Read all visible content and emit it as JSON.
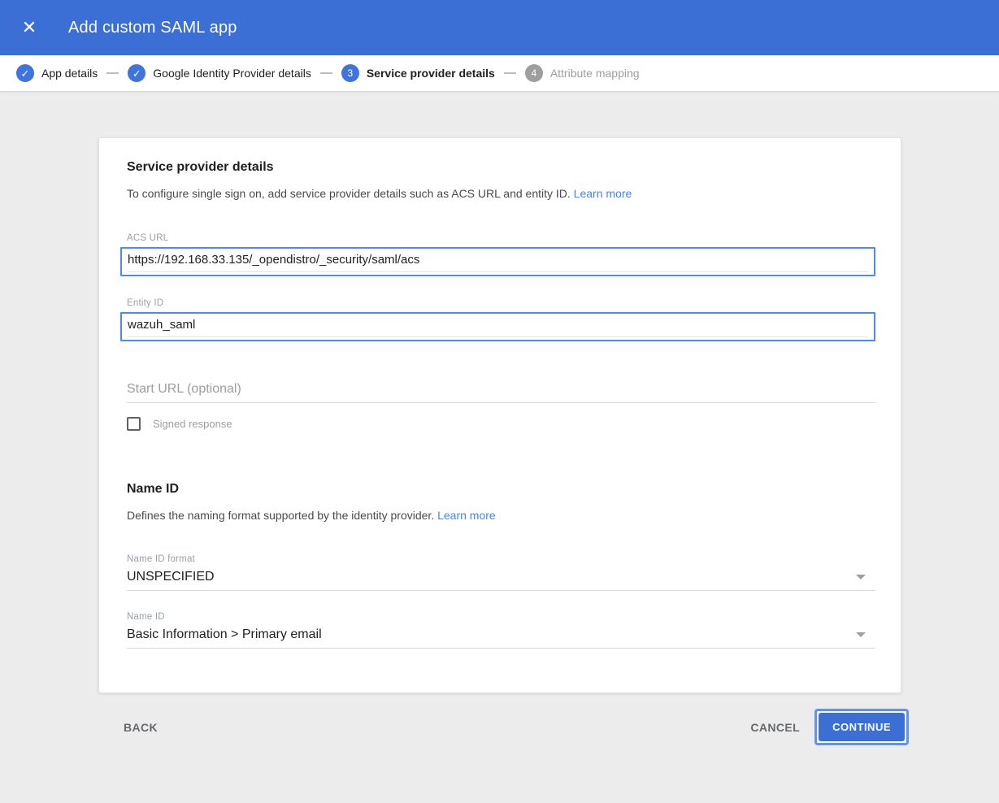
{
  "colors": {
    "header_bg": "#3b6fd6",
    "accent_blue": "#4285f4",
    "step_circle_blue": "#3e74dd",
    "step_circle_gray": "#9e9e9e",
    "focus_ring_blue": "#5e93f1",
    "link_blue": "#4285f4",
    "page_bg": "#ececec"
  },
  "icons": {
    "close": "✕",
    "check": "✓"
  },
  "header": {
    "title": "Add custom SAML app"
  },
  "stepper": {
    "steps": [
      {
        "label": "App details",
        "state": "complete"
      },
      {
        "label": "Google Identity Provider details",
        "state": "complete"
      },
      {
        "label": "Service provider details",
        "state": "current",
        "number": "3"
      },
      {
        "label": "Attribute mapping",
        "state": "upcoming",
        "number": "4"
      }
    ]
  },
  "card": {
    "service_provider": {
      "title": "Service provider details",
      "description": "To configure single sign on, add service provider details such as ACS URL and entity ID.",
      "learn_more": "Learn more"
    },
    "fields": {
      "acs_url": {
        "label": "ACS URL",
        "value": "https://192.168.33.135/_opendistro/_security/saml/acs"
      },
      "entity_id": {
        "label": "Entity ID",
        "value": "wazuh_saml"
      },
      "start_url": {
        "placeholder": "Start URL (optional)",
        "value": ""
      },
      "signed_response": {
        "label": "Signed response",
        "checked": false
      }
    },
    "name_id": {
      "title": "Name ID",
      "description": "Defines the naming format supported by the identity provider.",
      "learn_more": "Learn more"
    },
    "selects": {
      "name_id_format": {
        "label": "Name ID format",
        "value": "UNSPECIFIED"
      },
      "name_id": {
        "label": "Name ID",
        "value": "Basic Information > Primary email"
      }
    }
  },
  "footer": {
    "back": "BACK",
    "cancel": "CANCEL",
    "continue": "CONTINUE"
  }
}
